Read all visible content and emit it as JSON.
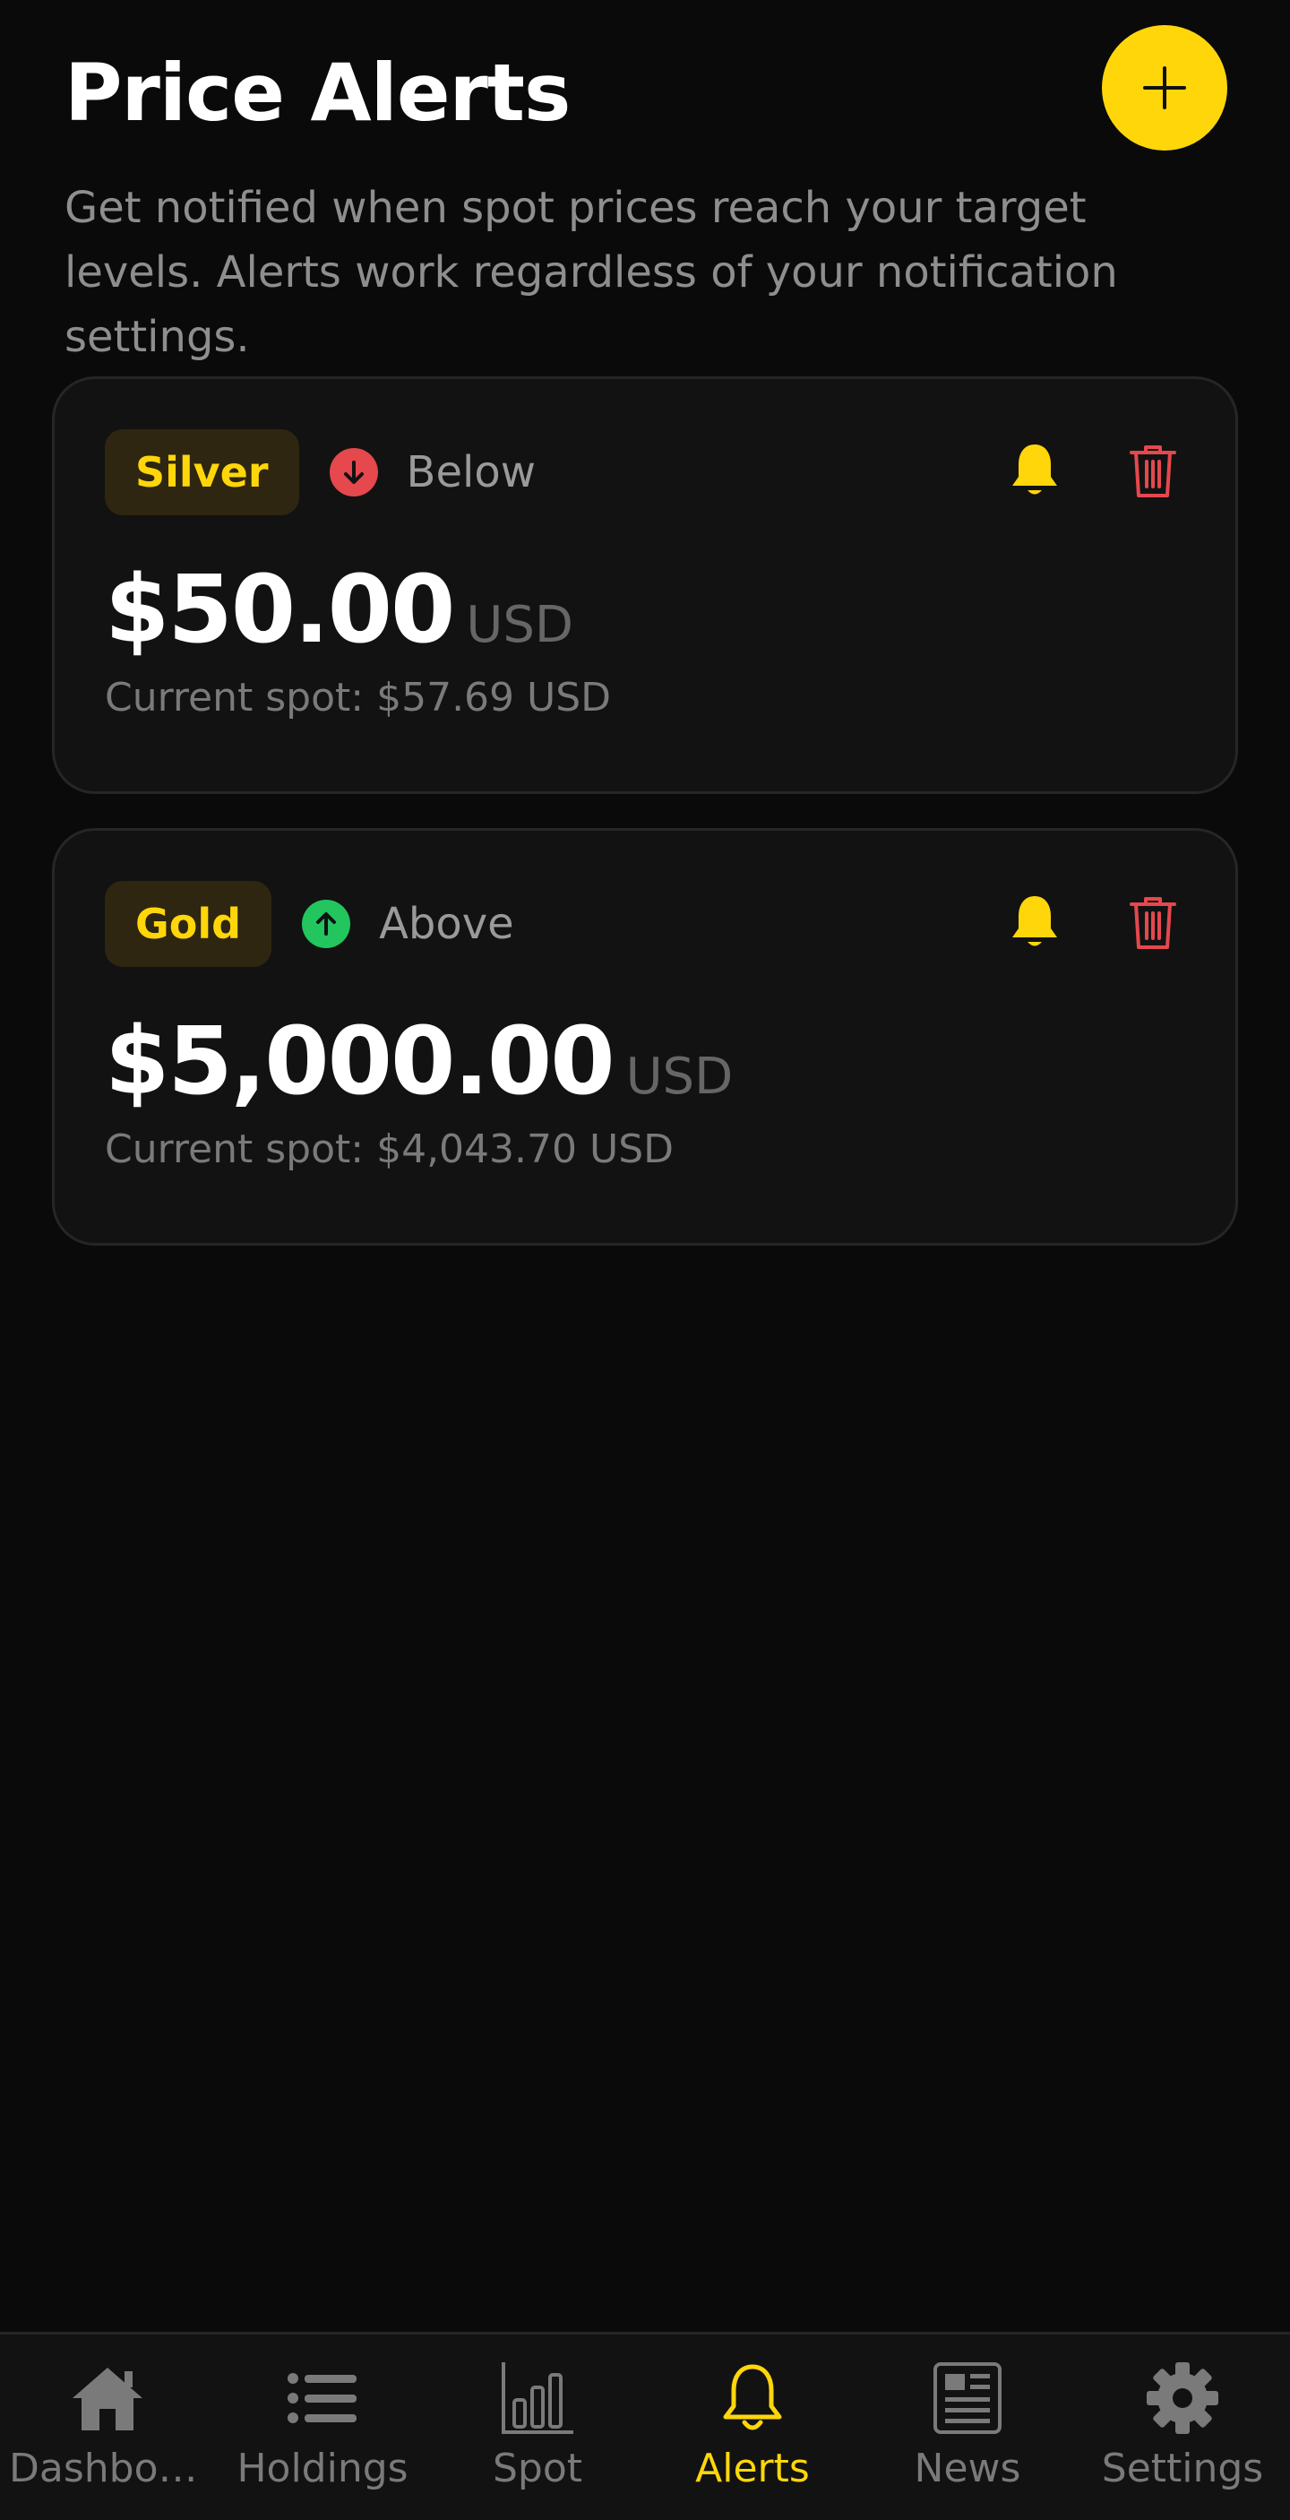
{
  "header": {
    "title": "Price Alerts",
    "add_icon": "plus-icon"
  },
  "subtitle": "Get notified when spot prices reach your target levels. Alerts work regardless of your notification settings.",
  "colors": {
    "accent": "#ffd60a",
    "below": "#e5484d",
    "above": "#22c55e",
    "delete": "#e5484d",
    "background": "#0a0a0a",
    "card": "#121212"
  },
  "alerts": [
    {
      "metal": "Silver",
      "direction": "Below",
      "direction_icon": "arrow-down-circle-icon",
      "price": "$50.00",
      "currency": "USD",
      "current_spot": "Current spot: $57.69 USD"
    },
    {
      "metal": "Gold",
      "direction": "Above",
      "direction_icon": "arrow-up-circle-icon",
      "price": "$5,000.00",
      "currency": "USD",
      "current_spot": "Current spot: $4,043.70 USD"
    }
  ],
  "nav": [
    {
      "label": "Dashboa...",
      "icon": "home-icon",
      "active": false
    },
    {
      "label": "Holdings",
      "icon": "list-icon",
      "active": false
    },
    {
      "label": "Spot",
      "icon": "bar-chart-icon",
      "active": false
    },
    {
      "label": "Alerts",
      "icon": "bell-icon",
      "active": true
    },
    {
      "label": "News",
      "icon": "newspaper-icon",
      "active": false
    },
    {
      "label": "Settings",
      "icon": "gear-icon",
      "active": false
    }
  ]
}
